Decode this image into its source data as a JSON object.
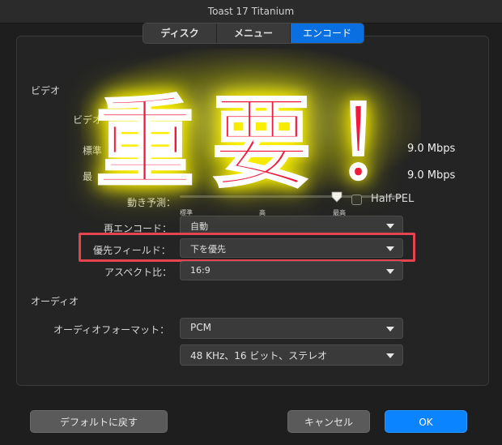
{
  "window": {
    "title": "Toast 17 Titanium"
  },
  "tabs": [
    {
      "label": "ディスク"
    },
    {
      "label": "メニュー"
    },
    {
      "label": "エンコード",
      "active": true
    }
  ],
  "video": {
    "section": "ビデオ",
    "video_label": "ビデオ",
    "standard_label": "標準",
    "max_label": "最",
    "standard_rate": "9.0 Mbps",
    "max_rate": "9.0 Mbps",
    "motion_label": "動き予測：",
    "half_pel_label": "Half-PEL",
    "half_pel_checked": false,
    "slider_ticks": [
      "標準",
      "高",
      "最高"
    ],
    "slider_level": "最高",
    "reencode_label": "再エンコード：",
    "reencode_value": "自動",
    "field_label": "優先フィールド：",
    "field_value": "下を優先",
    "aspect_label": "アスペクト比：",
    "aspect_value": "16:9"
  },
  "audio": {
    "section": "オーディオ",
    "format_label": "オーディオフォーマット：",
    "format_value": "PCM",
    "quality_value": "48 KHz、16 ビット、ステレオ"
  },
  "buttons": {
    "defaults": "デフォルトに戻す",
    "cancel": "キャンセル",
    "ok": "OK"
  },
  "overlay": {
    "text1": "重",
    "text2": "要",
    "text3": "！"
  },
  "colors": {
    "accent": "#0a6fe0",
    "highlight": "#e4434f",
    "overlay_text": "#f01b3c",
    "overlay_glow": "#fff200"
  }
}
